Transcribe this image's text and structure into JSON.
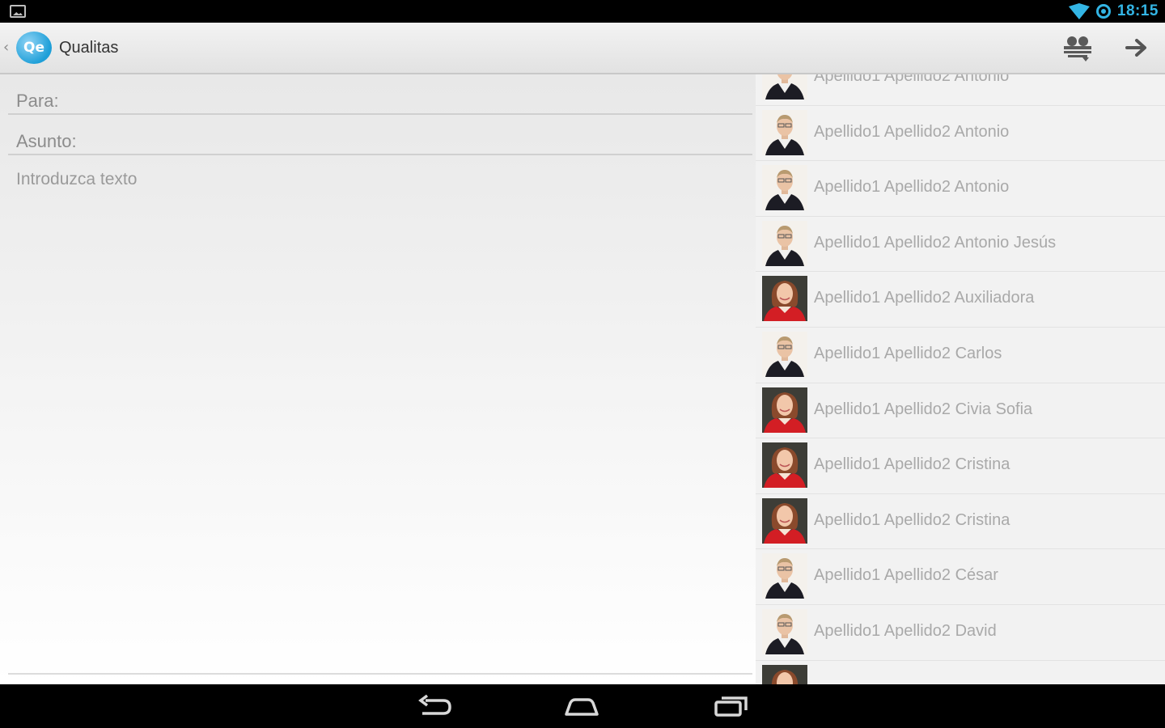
{
  "status_bar": {
    "time": "18:15",
    "icons": [
      "image-notification-icon",
      "wifi-icon",
      "sync-icon"
    ],
    "accent": "#33b5e5"
  },
  "action_bar": {
    "logo_text": "Qe",
    "title": "Qualitas",
    "icons": [
      "back-chevron-icon",
      "contacts-group-icon",
      "send-arrow-icon"
    ]
  },
  "compose": {
    "to_placeholder": "Para:",
    "subject_placeholder": "Asunto:",
    "body_placeholder": "Introduzca texto"
  },
  "contacts": [
    {
      "name": "Apellido1 Apellido2 Antonio",
      "avatar": "male"
    },
    {
      "name": "Apellido1 Apellido2 Antonio",
      "avatar": "male"
    },
    {
      "name": "Apellido1 Apellido2 Antonio",
      "avatar": "male"
    },
    {
      "name": "Apellido1 Apellido2 Antonio Jesús",
      "avatar": "male"
    },
    {
      "name": "Apellido1 Apellido2 Auxiliadora",
      "avatar": "female"
    },
    {
      "name": "Apellido1 Apellido2 Carlos",
      "avatar": "male"
    },
    {
      "name": "Apellido1 Apellido2 Civia Sofia",
      "avatar": "female"
    },
    {
      "name": "Apellido1 Apellido2 Cristina",
      "avatar": "female"
    },
    {
      "name": "Apellido1 Apellido2 Cristina",
      "avatar": "female"
    },
    {
      "name": "Apellido1 Apellido2 César",
      "avatar": "male"
    },
    {
      "name": "Apellido1 Apellido2 David",
      "avatar": "male"
    }
  ],
  "nav_bar": {
    "icons": [
      "back-icon",
      "home-icon",
      "recent-apps-icon"
    ]
  }
}
